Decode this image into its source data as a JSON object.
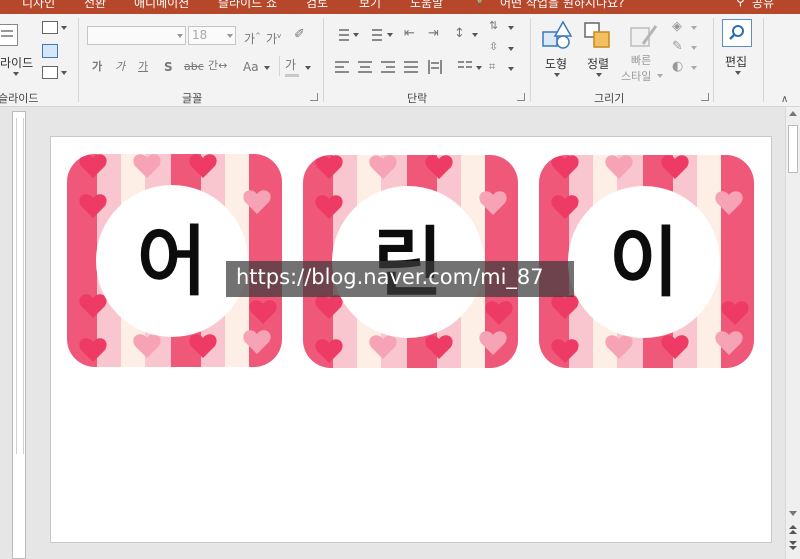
{
  "ribbon": {
    "tabs": [
      "디자인",
      "전환",
      "애니메이션",
      "슬라이드 쇼",
      "검토",
      "보기",
      "도움말",
      "어떤 작업을 원하시나요?",
      "공유"
    ],
    "groups": {
      "slides": {
        "label": "슬라이드",
        "new_slide_label": "라이드"
      },
      "font": {
        "label": "글꼴",
        "font_name": "",
        "font_size": "18"
      },
      "paragraph": {
        "label": "단락"
      },
      "drawing": {
        "label": "그리기",
        "shapes_label": "도형",
        "arrange_label": "정렬",
        "quick_styles_label": "빠른\n스타일"
      },
      "editing": {
        "label": "편집",
        "edit_label": "편집"
      }
    }
  },
  "slide": {
    "cards": [
      {
        "character": "어"
      },
      {
        "character": "린"
      },
      {
        "character": "이"
      }
    ],
    "card_colors": {
      "pink_light": "#f9c6cf",
      "pink_dark": "#f0587a",
      "cream": "#fdeee6",
      "heart": "#ed3b66",
      "heart_soft": "#f7a3b6"
    },
    "watermark": "https://blog.naver.com/mi_87"
  }
}
